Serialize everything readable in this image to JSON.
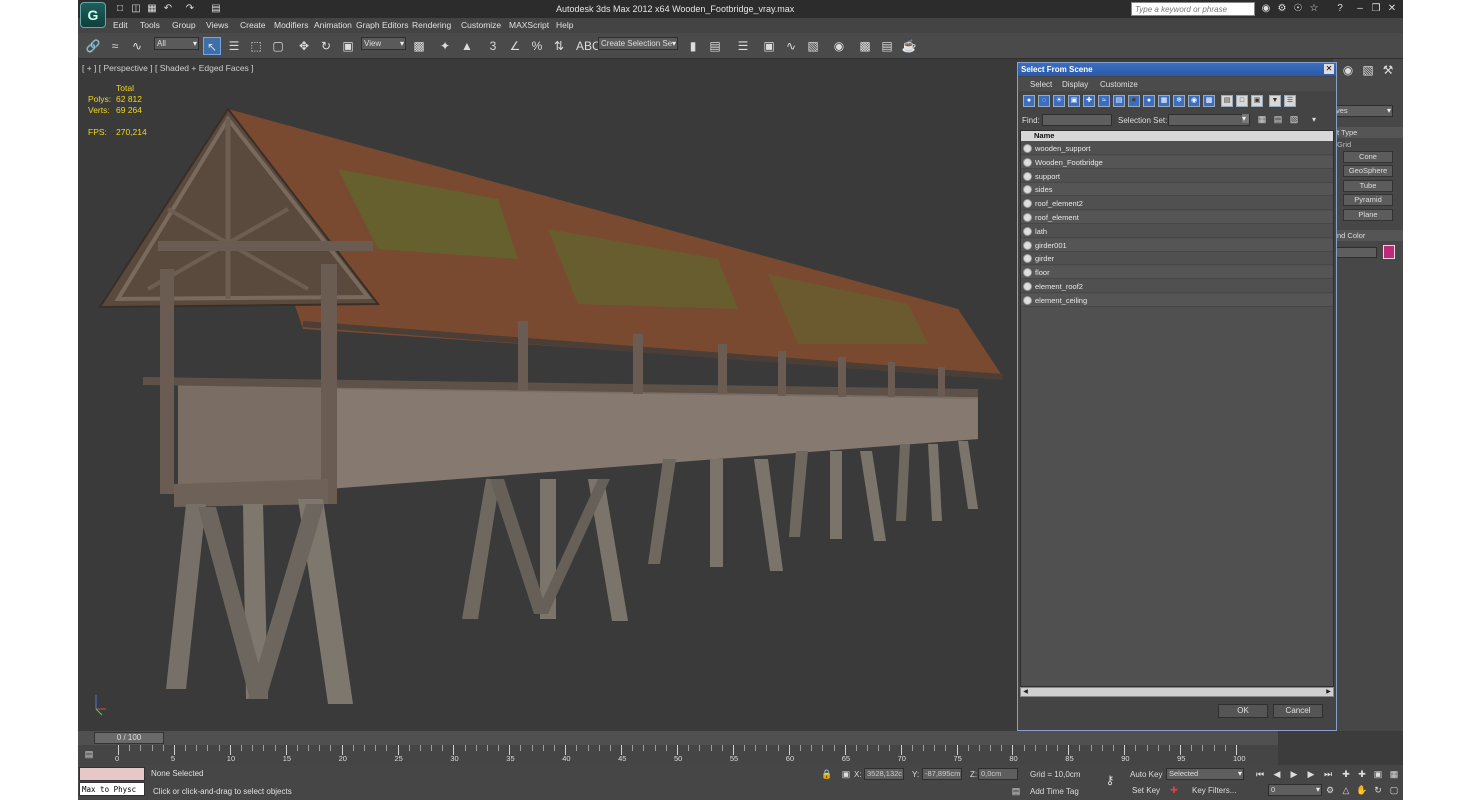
{
  "titlebar": {
    "title": "Autodesk 3ds Max  2012 x64     Wooden_Footbridge_vray.max",
    "search_placeholder": "Type a keyword or phrase"
  },
  "menu": [
    "Edit",
    "Tools",
    "Group",
    "Views",
    "Create",
    "Modifiers",
    "Animation",
    "Graph Editors",
    "Rendering",
    "Customize",
    "MAXScript",
    "Help"
  ],
  "toolbar": {
    "filter_value": "All",
    "refcoord_value": "View",
    "selection_set_value": "Create Selection Se",
    "snap_3": "3",
    "snap_percent": "%",
    "abc_label": "ABC"
  },
  "viewport": {
    "label": "[ + ] [ Perspective ] [ Shaded + Edged Faces ]",
    "stats": {
      "total_label": "Total",
      "polys_label": "Polys:",
      "polys_value": "62 812",
      "verts_label": "Verts:",
      "verts_value": "69 264",
      "fps_label": "FPS:",
      "fps_value": "270,214"
    }
  },
  "dialog": {
    "title": "Select From Scene",
    "menu": [
      "Select",
      "Display",
      "Customize"
    ],
    "find_label": "Find:",
    "selection_set_label": "Selection Set:",
    "column_name": "Name",
    "objects": [
      "wooden_support",
      "Wooden_Footbridge",
      "support",
      "sides",
      "roof_element2",
      "roof_element",
      "lath",
      "girder001",
      "girder",
      "floor",
      "element_roof2",
      "element_ceiling"
    ],
    "ok_label": "OK",
    "cancel_label": "Cancel"
  },
  "command_panel": {
    "drop_value": "ves",
    "object_type_label": "t Type",
    "grid_label": "Grid",
    "buttons": [
      "Cone",
      "GeoSphere",
      "Tube",
      "Pyramid",
      "Plane"
    ],
    "color_label": "nd Color",
    "swatch_color": "#c0287a"
  },
  "timeline": {
    "slider_label": "0 / 100",
    "tick_labels": [
      "0",
      "5",
      "10",
      "15",
      "20",
      "25",
      "30",
      "35",
      "40",
      "45",
      "50",
      "55",
      "60",
      "65",
      "70",
      "75",
      "80",
      "85",
      "90",
      "95",
      "100"
    ]
  },
  "status": {
    "maxscript_label": "Max to Physc",
    "selection_status": "None Selected",
    "prompt": "Click or click-and-drag to select objects",
    "x_label": "X:",
    "x_value": "3528,132c",
    "y_label": "Y:",
    "y_value": "-87,895cm",
    "z_label": "Z:",
    "z_value": "0,0cm",
    "grid_text": "Grid = 10,0cm",
    "add_time_tag": "Add Time Tag",
    "auto_key": "Auto Key",
    "auto_key_value": "Selected",
    "set_key": "Set Key",
    "key_filters": "Key Filters...",
    "frame_value": "0"
  }
}
